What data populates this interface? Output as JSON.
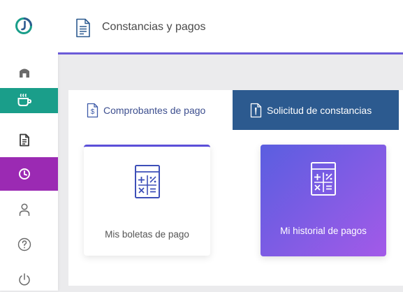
{
  "header": {
    "title": "Constancias y pagos"
  },
  "sidebar": {
    "items": [
      {
        "name": "home-icon"
      },
      {
        "name": "cup-icon"
      },
      {
        "name": "document-icon"
      },
      {
        "name": "clock-icon"
      },
      {
        "name": "user-icon"
      },
      {
        "name": "help-icon"
      },
      {
        "name": "power-icon"
      }
    ],
    "active_colors": {
      "cup": "#1a9e8a",
      "clock": "#9b2ab3"
    }
  },
  "tabs": [
    {
      "label": "Comprobantes de pago",
      "active": true
    },
    {
      "label": "Solicitud de constancias",
      "active": false
    }
  ],
  "cards": [
    {
      "label": "Mis boletas de pago",
      "icon": "calculator-icon"
    },
    {
      "label": "Mi historial de pagos",
      "icon": "calculator-icon"
    }
  ],
  "colors": {
    "accent": "#6b5bd8",
    "tab_inactive_bg": "#2c5a8f",
    "gradient_start": "#5a5ee0",
    "gradient_end": "#a35ae8"
  }
}
